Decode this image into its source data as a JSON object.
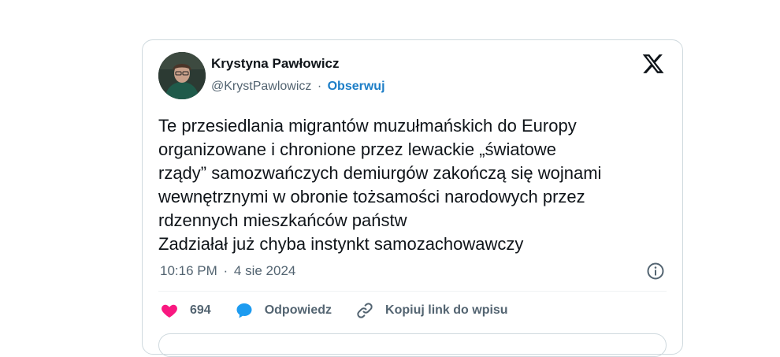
{
  "author": {
    "name": "Krystyna Pawłowicz",
    "handle": "@KrystPawlowicz",
    "separator": "·",
    "follow_label": "Obserwuj"
  },
  "tweet": {
    "text": "Te przesiedlania migrantów muzułmańskich do Europy\norganizowane i chronione przez lewackie „światowe\nrządy” samozwańczych demiurgów zakończą się wojnami\nwewnętrznymi w obronie tożsamości narodowych przez\nrdzennych mieszkańców  państw\nZadziałał już chyba instynkt samozachowawczy",
    "time": "10:16 PM",
    "date_separator": "·",
    "date": "4 sie 2024"
  },
  "actions": {
    "like_count": "694",
    "reply_label": "Odpowiedz",
    "copy_link_label": "Kopiuj link do wpisu"
  },
  "colors": {
    "like": "#f91880",
    "reply": "#1d9bf0",
    "follow": "#1d7ec7",
    "muted": "#536471",
    "border": "#cfd9de"
  },
  "icons": {
    "logo": "x-logo-icon",
    "info": "info-icon",
    "like": "heart-icon",
    "reply": "speech-bubble-icon",
    "link": "link-icon"
  }
}
